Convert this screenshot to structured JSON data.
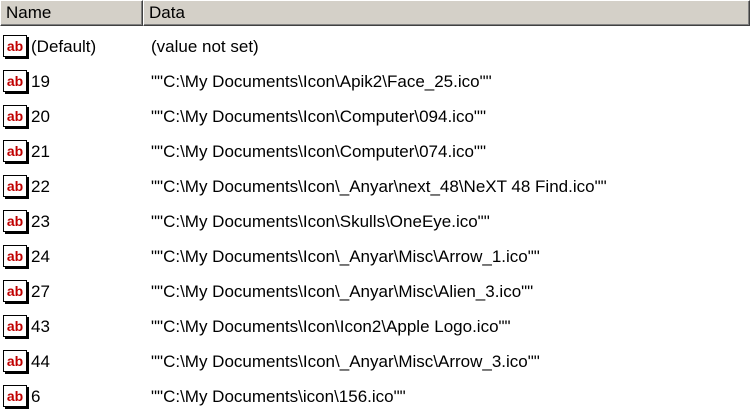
{
  "columns": {
    "name": "Name",
    "data": "Data"
  },
  "icon": "registry-string-value-icon",
  "icon_glyph": "ab",
  "icon_color": "#c00000",
  "rows": [
    {
      "name": "(Default)",
      "data": "(value not set)"
    },
    {
      "name": "19",
      "data": "\"\"C:\\My Documents\\Icon\\Apik2\\Face_25.ico\"\""
    },
    {
      "name": "20",
      "data": "\"\"C:\\My Documents\\Icon\\Computer\\094.ico\"\""
    },
    {
      "name": "21",
      "data": "\"\"C:\\My Documents\\Icon\\Computer\\074.ico\"\""
    },
    {
      "name": "22",
      "data": "\"\"C:\\My Documents\\Icon\\_Anyar\\next_48\\NeXT 48 Find.ico\"\""
    },
    {
      "name": "23",
      "data": "\"\"C:\\My Documents\\Icon\\Skulls\\OneEye.ico\"\""
    },
    {
      "name": "24",
      "data": "\"\"C:\\My Documents\\Icon\\_Anyar\\Misc\\Arrow_1.ico\"\""
    },
    {
      "name": "27",
      "data": "\"\"C:\\My Documents\\Icon\\_Anyar\\Misc\\Alien_3.ico\"\""
    },
    {
      "name": "43",
      "data": "\"\"C:\\My Documents\\Icon\\Icon2\\Apple Logo.ico\"\""
    },
    {
      "name": "44",
      "data": "\"\"C:\\My Documents\\Icon\\_Anyar\\Misc\\Arrow_3.ico\"\""
    },
    {
      "name": "6",
      "data": "\"\"C:\\My Documents\\icon\\156.ico\"\""
    }
  ]
}
